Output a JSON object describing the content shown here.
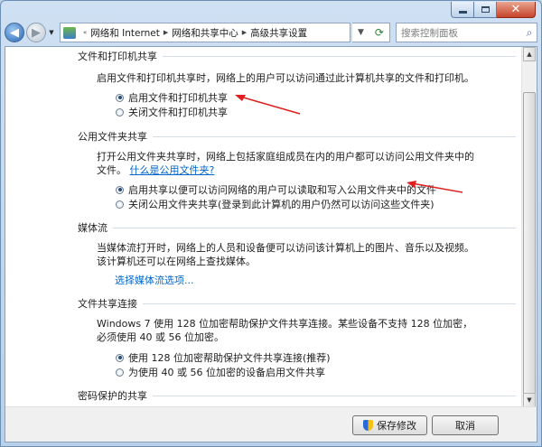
{
  "nav": {
    "breadcrumb": [
      "网络和 Internet",
      "网络和共享中心",
      "高级共享设置"
    ],
    "search_placeholder": "搜索控制面板"
  },
  "sections": {
    "file_printer": {
      "title": "文件和打印机共享",
      "description": "启用文件和打印机共享时，网络上的用户可以访问通过此计算机共享的文件和打印机。",
      "options": [
        {
          "label": "启用文件和打印机共享",
          "selected": true
        },
        {
          "label": "关闭文件和打印机共享",
          "selected": false
        }
      ]
    },
    "public_folder": {
      "title": "公用文件夹共享",
      "description": "打开公用文件夹共享时，网络上包括家庭组成员在内的用户都可以访问公用文件夹中的文件。",
      "link": "什么是公用文件夹?",
      "options": [
        {
          "label": "启用共享以便可以访问网络的用户可以读取和写入公用文件夹中的文件",
          "selected": true
        },
        {
          "label": "关闭公用文件夹共享(登录到此计算机的用户仍然可以访问这些文件夹)",
          "selected": false
        }
      ]
    },
    "media": {
      "title": "媒体流",
      "description": "当媒体流打开时，网络上的人员和设备便可以访问该计算机上的图片、音乐以及视频。该计算机还可以在网络上查找媒体。",
      "link": "选择媒体流选项..."
    },
    "connection": {
      "title": "文件共享连接",
      "description": "Windows 7 使用 128 位加密帮助保护文件共享连接。某些设备不支持 128 位加密，必须使用 40 或 56 位加密。",
      "options": [
        {
          "label": "使用 128 位加密帮助保护文件共享连接(推荐)",
          "selected": true
        },
        {
          "label": "为使用 40 或 56 位加密的设备启用文件共享",
          "selected": false
        }
      ]
    },
    "password": {
      "title": "密码保护的共享"
    }
  },
  "footer": {
    "save_label": "保存修改",
    "cancel_label": "取消"
  },
  "colors": {
    "link": "#0066cc",
    "annotation_arrow": "#e02020"
  }
}
